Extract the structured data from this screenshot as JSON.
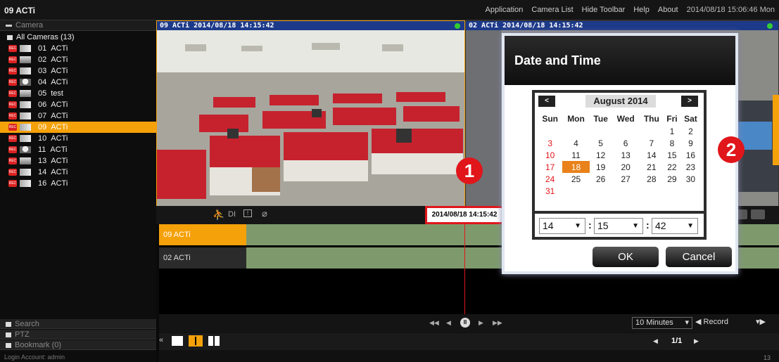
{
  "app_title": "09 ACTi",
  "menu": [
    "Application",
    "Camera List",
    "Hide Toolbar",
    "Help",
    "About"
  ],
  "datetime_display": "2014/08/18 15:06:46 Mon",
  "sidebar": {
    "camera_header": "Camera",
    "group": "All Cameras (13)",
    "cameras": [
      {
        "id": "01",
        "name": "ACTi"
      },
      {
        "id": "02",
        "name": "ACTi"
      },
      {
        "id": "03",
        "name": "ACTi"
      },
      {
        "id": "04",
        "name": "ACTi"
      },
      {
        "id": "05",
        "name": "test"
      },
      {
        "id": "06",
        "name": "ACTi"
      },
      {
        "id": "07",
        "name": "ACTi"
      },
      {
        "id": "09",
        "name": "ACTi"
      },
      {
        "id": "10",
        "name": "ACTi"
      },
      {
        "id": "11",
        "name": "ACTi"
      },
      {
        "id": "13",
        "name": "ACTi"
      },
      {
        "id": "14",
        "name": "ACTi"
      },
      {
        "id": "16",
        "name": "ACTi"
      }
    ],
    "selected_index": 7,
    "search": "Search",
    "ptz": "PTZ",
    "bookmark": "Bookmark (0)",
    "login": "Login Account: admin"
  },
  "panes": [
    {
      "title": "09 ACTi  2014/08/18 14:15:42"
    },
    {
      "title": "02 ACTi  2014/08/18 14:15:42"
    }
  ],
  "toolbar": {
    "di": "DI"
  },
  "timestamp_box": "2014/08/18 14:15:42",
  "markers": {
    "one": "1",
    "two": "2"
  },
  "tracks": [
    "09 ACTi",
    "02 ACTi"
  ],
  "bottom": {
    "interval": "10 Minutes",
    "record": "Record",
    "page": "1/1",
    "count": "13"
  },
  "dialog": {
    "title": "Date and Time",
    "month": "August 2014",
    "weekdays": [
      "Sun",
      "Mon",
      "Tue",
      "Wed",
      "Thu",
      "Fri",
      "Sat"
    ],
    "weeks": [
      [
        "",
        "",
        "",
        "",
        "",
        "1",
        "2"
      ],
      [
        "3",
        "4",
        "5",
        "6",
        "7",
        "8",
        "9"
      ],
      [
        "10",
        "11",
        "12",
        "13",
        "14",
        "15",
        "16"
      ],
      [
        "17",
        "18",
        "19",
        "20",
        "21",
        "22",
        "23"
      ],
      [
        "24",
        "25",
        "26",
        "27",
        "28",
        "29",
        "30"
      ],
      [
        "31",
        "",
        "",
        "",
        "",
        "",
        ""
      ]
    ],
    "selected_day": "18",
    "hour": "14",
    "minute": "15",
    "second": "42",
    "ok": "OK",
    "cancel": "Cancel"
  },
  "colors": {
    "accent": "#f5a10a",
    "rec": "#d22222",
    "pane_header": "#1d3a8a",
    "track": "#7e9a6c",
    "marker": "#e0161b"
  }
}
